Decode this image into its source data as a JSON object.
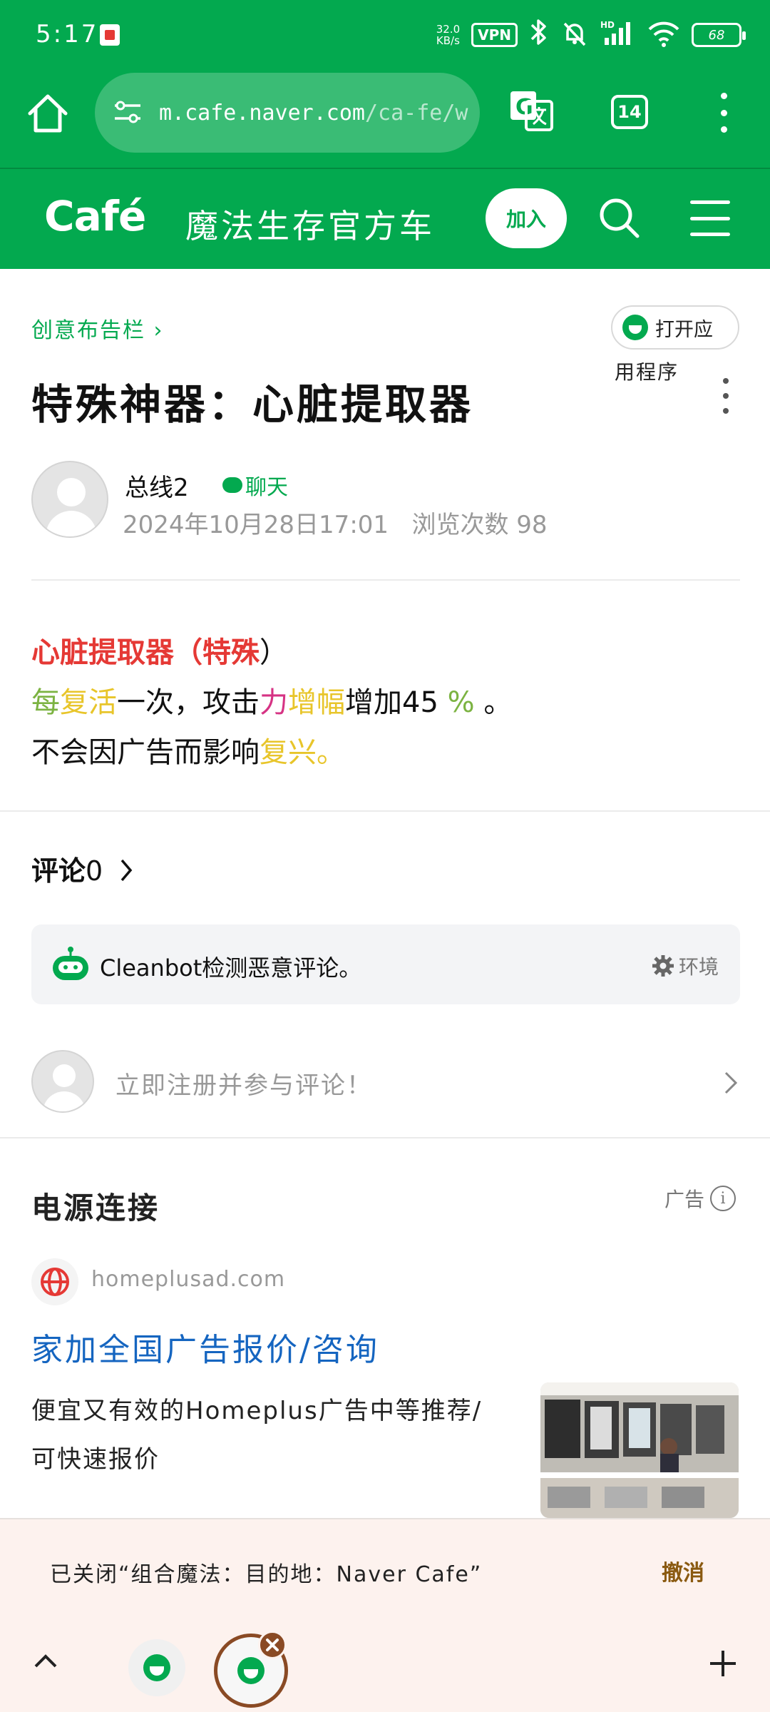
{
  "status_bar": {
    "time": "5:17",
    "net_speed_value": "32.0",
    "net_speed_unit": "KB/s",
    "vpn_label": "VPN",
    "signal_label": "HD",
    "battery": "68"
  },
  "browser": {
    "url_host": "m.cafe.naver.com",
    "url_path": "/ca-fe/w",
    "tab_count": "14"
  },
  "cafe_header": {
    "logo": "Café",
    "cafe_name": "魔法生存官方车",
    "join_label": "加入"
  },
  "post": {
    "board_name": "创意布告栏 ›",
    "open_app_line1": "打开应",
    "open_app_line2": "用程序",
    "title": "特殊神器：心脏提取器",
    "author": "总线2",
    "chat_label": "聊天",
    "date": "2024年10月28日17:01",
    "views": "浏览次数 98",
    "body": {
      "line1_red": "心脏提取器（特殊",
      "line1_end": "）",
      "line2_a": "每",
      "line2_b": "复活",
      "line2_c": "一次，攻击",
      "line2_d": "力",
      "line2_e": "增幅",
      "line2_f": "增加45 ",
      "line2_g": "%",
      "line2_h": " 。",
      "line3_a": "不会因广告而影响",
      "line3_b": "复兴",
      "line3_c": "。"
    }
  },
  "comments": {
    "label": "评论",
    "count": "0",
    "cleanbot_text": "Cleanbot检测恶意评论。",
    "cleanbot_settings": "环境",
    "register_prompt": "立即注册并参与评论！"
  },
  "ad": {
    "section_title": "电源连接",
    "ad_label": "广告",
    "domain": "homeplusad.com",
    "headline": "家加全国广告报价/咨询",
    "description": "便宜又有效的Homeplus广告中等推荐/可快速报价"
  },
  "snackbar": {
    "message": "已关闭“组合魔法：目的地：Naver Cafe”",
    "undo_label": "撤消"
  },
  "colors": {
    "brand_green": "#03a94f",
    "link_blue": "#1565c0",
    "highlight_red": "#e53935"
  }
}
